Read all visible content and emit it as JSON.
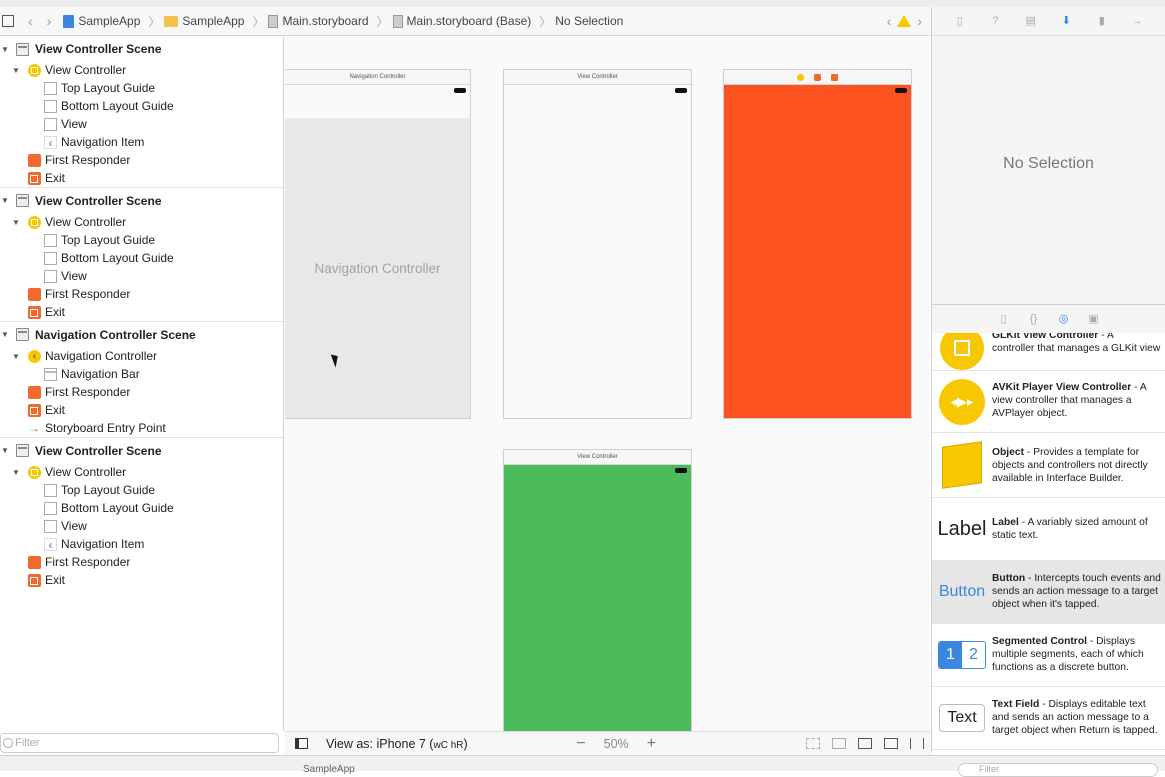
{
  "breadcrumb": {
    "items": [
      "SampleApp",
      "SampleApp",
      "Main.storyboard",
      "Main.storyboard (Base)",
      "No Selection"
    ]
  },
  "outline": {
    "scenes": [
      {
        "title": "View Controller Scene",
        "items": [
          {
            "label": "View Controller",
            "icon": "view-controller-icon",
            "level": 1,
            "disclosure": true
          },
          {
            "label": "Top Layout Guide",
            "icon": "layout-guide-icon",
            "level": 2
          },
          {
            "label": "Bottom Layout Guide",
            "icon": "layout-guide-icon",
            "level": 2
          },
          {
            "label": "View",
            "icon": "view-icon",
            "level": 2
          },
          {
            "label": "Navigation Item",
            "icon": "navigation-item-icon",
            "level": 2
          },
          {
            "label": "First Responder",
            "icon": "first-responder-icon",
            "level": 1
          },
          {
            "label": "Exit",
            "icon": "exit-icon",
            "level": 1
          }
        ]
      },
      {
        "title": "View Controller Scene",
        "items": [
          {
            "label": "View Controller",
            "icon": "view-controller-icon",
            "level": 1,
            "disclosure": true
          },
          {
            "label": "Top Layout Guide",
            "icon": "layout-guide-icon",
            "level": 2
          },
          {
            "label": "Bottom Layout Guide",
            "icon": "layout-guide-icon",
            "level": 2
          },
          {
            "label": "View",
            "icon": "view-icon",
            "level": 2
          },
          {
            "label": "First Responder",
            "icon": "first-responder-icon",
            "level": 1
          },
          {
            "label": "Exit",
            "icon": "exit-icon",
            "level": 1
          }
        ]
      },
      {
        "title": "Navigation Controller Scene",
        "items": [
          {
            "label": "Navigation Controller",
            "icon": "navigation-controller-icon",
            "level": 1,
            "disclosure": true
          },
          {
            "label": "Navigation Bar",
            "icon": "navigation-bar-icon",
            "level": 2
          },
          {
            "label": "First Responder",
            "icon": "first-responder-icon",
            "level": 1
          },
          {
            "label": "Exit",
            "icon": "exit-icon",
            "level": 1
          },
          {
            "label": "Storyboard Entry Point",
            "icon": "entry-point-arrow-icon",
            "level": 1
          }
        ]
      },
      {
        "title": "View Controller Scene",
        "items": [
          {
            "label": "View Controller",
            "icon": "view-controller-icon",
            "level": 1,
            "disclosure": true
          },
          {
            "label": "Top Layout Guide",
            "icon": "layout-guide-icon",
            "level": 2
          },
          {
            "label": "Bottom Layout Guide",
            "icon": "layout-guide-icon",
            "level": 2
          },
          {
            "label": "View",
            "icon": "view-icon",
            "level": 2
          },
          {
            "label": "Navigation Item",
            "icon": "navigation-item-icon",
            "level": 2
          },
          {
            "label": "First Responder",
            "icon": "first-responder-icon",
            "level": 1
          },
          {
            "label": "Exit",
            "icon": "exit-icon",
            "level": 1
          }
        ]
      }
    ],
    "filter_placeholder": "Filter"
  },
  "canvas": {
    "frames": [
      {
        "title": "Navigation Controller",
        "body_label": "Navigation Controller",
        "bg": "#e8e8e8"
      },
      {
        "title": "View Controller",
        "bg": "#fafafa"
      },
      {
        "title": "",
        "bg": "#fc521f"
      },
      {
        "title": "View Controller",
        "bg": "#4cbb5b"
      }
    ]
  },
  "bottom_bar": {
    "view_as_prefix": "View as: iPhone 7 (",
    "size_class": "wC hR",
    "view_as_suffix": ")",
    "zoom": "50%",
    "zoom_out": "−",
    "zoom_in": "+"
  },
  "inspector": {
    "empty_label": "No Selection"
  },
  "library": {
    "items": [
      {
        "name": "GLKit View Controller",
        "desc": " - A",
        "lines": [
          "controller that manages a GLKit view"
        ],
        "thumb": "glkit-icon"
      },
      {
        "name": "AVKit Player View Controller",
        "desc": " - A",
        "lines": [
          "view controller that manages a",
          "AVPlayer object."
        ],
        "thumb": "avkit-icon"
      },
      {
        "name": "Object",
        "desc": " - Provides a template for",
        "lines": [
          "objects and controllers not directly",
          "available in Interface Builder."
        ],
        "thumb": "object-cube-icon"
      },
      {
        "name": "Label",
        "desc": " - A variably sized amount of",
        "lines": [
          "static text."
        ],
        "thumb_text": "Label"
      },
      {
        "name": "Button",
        "desc": " - Intercepts touch events and",
        "lines": [
          "sends an action message to a target",
          "object when it's tapped."
        ],
        "thumb_text": "Button"
      },
      {
        "name": "Segmented Control",
        "desc": " - Displays",
        "lines": [
          "multiple segments, each of which",
          "functions as a discrete button."
        ],
        "thumb_text_a": "1",
        "thumb_text_b": "2"
      },
      {
        "name": "Text Field",
        "desc": " - Displays editable text",
        "lines": [
          "and sends an action message to a",
          "target object when Return is tapped."
        ],
        "thumb_text": "Text"
      }
    ],
    "filter_placeholder": "Filter"
  },
  "status": {
    "project": "SampleApp"
  },
  "colors": {
    "accent": "#3a86e0",
    "warning": "#f7c700",
    "orange": "#fc521f",
    "green": "#4cbb5b"
  }
}
